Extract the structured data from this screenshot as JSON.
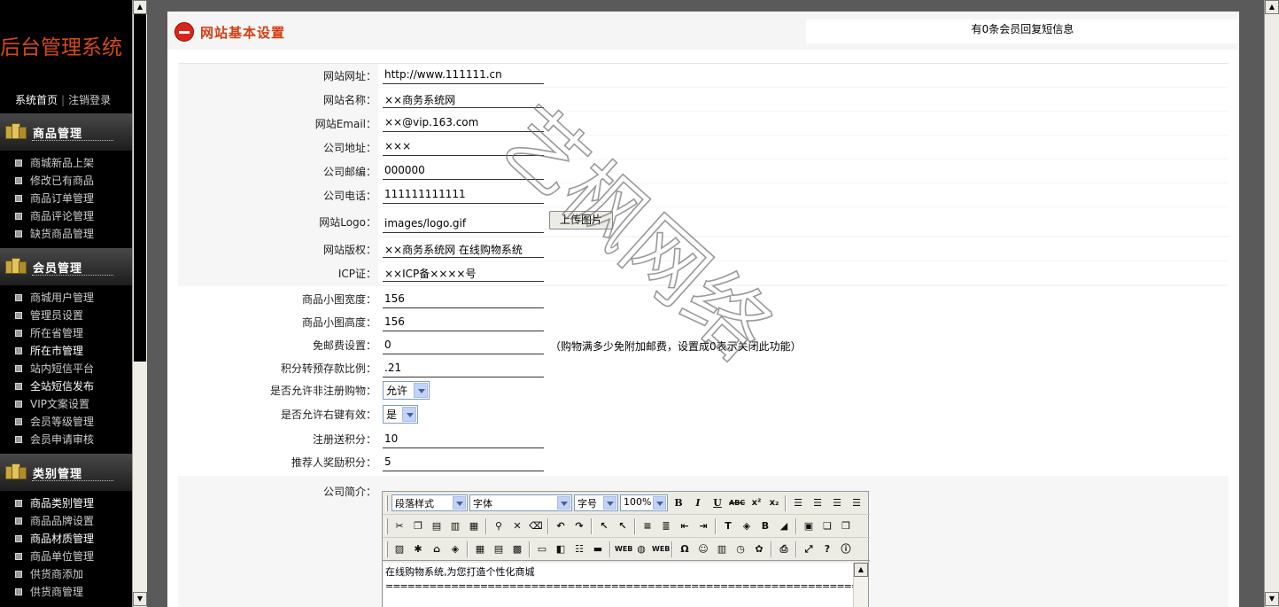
{
  "left": {
    "brand": "后台管理系统",
    "toplinks": [
      "系统首页",
      "注销登录"
    ],
    "sections": [
      {
        "title": "商品管理",
        "items": [
          "商城新品上架",
          "修改已有商品",
          "商品订单管理",
          "商品评论管理",
          "缺货商品管理"
        ]
      },
      {
        "title": "会员管理",
        "items": [
          "商城用户管理",
          "管理员设置",
          "所在省管理",
          "所在市管理",
          "站内短信平台",
          "全站短信发布",
          "VIP文案设置",
          "会员等级管理",
          "会员申请审核"
        ]
      },
      {
        "title": "类别管理",
        "items": [
          "商品类别管理",
          "商品品牌设置",
          "商品材质管理",
          "商品单位管理",
          "供货商添加",
          "供货商管理"
        ]
      }
    ]
  },
  "header": {
    "title": "网站基本设置",
    "message": "有0条会员回复短信息"
  },
  "form": {
    "site_url": {
      "label": "网站网址：",
      "value": "http://www.111111.cn"
    },
    "site_name": {
      "label": "网站名称：",
      "value": "××商务系统网"
    },
    "site_email": {
      "label": "网站Email：",
      "value": "××@vip.163.com"
    },
    "company_address": {
      "label": "公司地址：",
      "value": "×××"
    },
    "company_zip": {
      "label": "公司邮编：",
      "value": "000000"
    },
    "company_phone": {
      "label": "公司电话：",
      "value": "111111111111"
    },
    "site_logo": {
      "label": "网站Logo：",
      "value": "images/logo.gif",
      "button": "上传图片"
    },
    "site_copyright": {
      "label": "网站版权：",
      "value": "××商务系统网 在线购物系统"
    },
    "icp": {
      "label": "ICP证：",
      "value": "××ICP备××××号"
    },
    "thumb_width": {
      "label": "商品小图宽度：",
      "value": "156"
    },
    "thumb_height": {
      "label": "商品小图高度：",
      "value": "156"
    },
    "free_shipping": {
      "label": "免邮费设置：",
      "value": "0",
      "hint": "（购物满多少免附加邮费，设置成0表示关闭此功能）"
    },
    "points_ratio": {
      "label": "积分转预存款比例：",
      "value": ".21"
    },
    "guest_purchase": {
      "label": "是否允许非注册购物：",
      "value": "允许"
    },
    "right_click": {
      "label": "是否允许右键有效：",
      "value": "是"
    },
    "register_points": {
      "label": "注册送积分：",
      "value": "10"
    },
    "referrer_points": {
      "label": "推荐人奖励积分：",
      "value": "5"
    },
    "company_intro": {
      "label": "公司简介：",
      "toolbar": {
        "paragraph": "段落样式",
        "font": "字体",
        "size": "字号",
        "zoom": "100%"
      },
      "content_line1": "在线购物系统,为您打造个性化商城",
      "content_line2": "=====================================================================================",
      "content_line3": "=================================================================================="
    }
  },
  "watermark": {
    "text": "艺枫网络"
  }
}
